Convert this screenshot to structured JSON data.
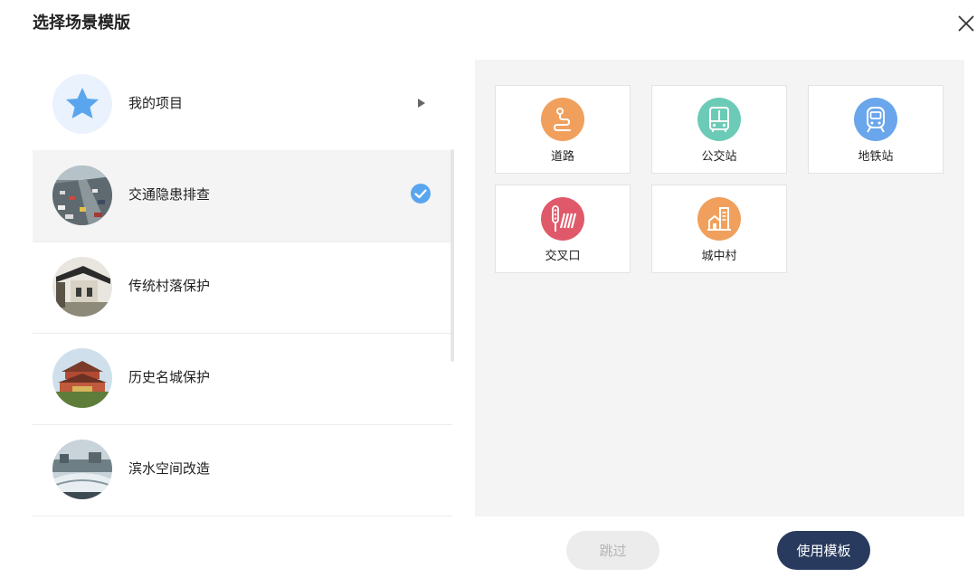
{
  "dialog": {
    "title": "选择场景模版"
  },
  "icons": {
    "close": "close-icon"
  },
  "scenes": [
    {
      "label": "我的项目",
      "icon": "star-icon",
      "indicator": "arrow"
    },
    {
      "label": "交通隐患排查",
      "icon": "traffic-photo",
      "indicator": "check",
      "selected": true
    },
    {
      "label": "传统村落保护",
      "icon": "village-photo"
    },
    {
      "label": "历史名城保护",
      "icon": "historic-city-photo"
    },
    {
      "label": "滨水空间改造",
      "icon": "waterfront-photo"
    }
  ],
  "templates": [
    {
      "label": "道路",
      "icon": "road-icon",
      "color": "#f0a05c"
    },
    {
      "label": "公交站",
      "icon": "bus-icon",
      "color": "#6ccbb6"
    },
    {
      "label": "地铁站",
      "icon": "metro-icon",
      "color": "#6aa6ec"
    },
    {
      "label": "交叉口",
      "icon": "intersection-icon",
      "color": "#e0596a"
    },
    {
      "label": "城中村",
      "icon": "urban-village-icon",
      "color": "#f0a05c"
    }
  ],
  "actions": {
    "skip": "跳过",
    "use_template": "使用模板"
  },
  "colors": {
    "check": "#5aa6ee",
    "primary_button": "#283a5e",
    "panel_bg": "#f4f4f4"
  }
}
